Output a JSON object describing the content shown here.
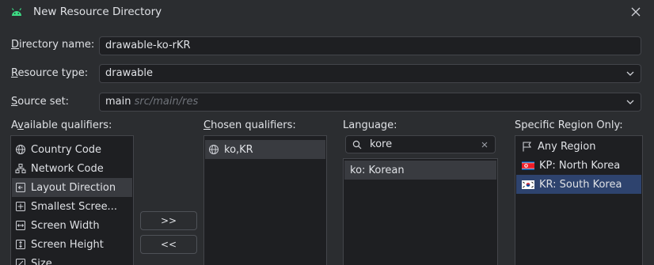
{
  "window": {
    "title": "New Resource Directory"
  },
  "form": {
    "directory_name_label_first": "D",
    "directory_name_label_rest": "irectory name:",
    "directory_name_value": "drawable-ko-rKR",
    "resource_type_label_first": "R",
    "resource_type_label_rest": "esource type:",
    "resource_type_value": "drawable",
    "source_set_label_first": "S",
    "source_set_label_rest": "ource set:",
    "source_set_value": "main",
    "source_set_path": "src/main/res"
  },
  "available": {
    "label_pre": "A",
    "label_u": "v",
    "label_rest": "ailable qualifiers:",
    "items": [
      {
        "label": "Country Code",
        "icon": "globe-icon"
      },
      {
        "label": "Network Code",
        "icon": "network-icon"
      },
      {
        "label": "Layout Direction",
        "icon": "layout-direction-icon"
      },
      {
        "label": "Smallest Scree...",
        "icon": "smallest-screen-icon"
      },
      {
        "label": "Screen Width",
        "icon": "screen-width-icon"
      },
      {
        "label": "Screen Height",
        "icon": "screen-height-icon"
      },
      {
        "label": "Size",
        "icon": "size-icon"
      }
    ]
  },
  "buttons": {
    "add": ">>",
    "remove": "<<"
  },
  "chosen": {
    "label_first": "C",
    "label_rest": "hosen qualifiers:",
    "items": [
      {
        "label": "ko,KR",
        "icon": "globe-icon"
      }
    ]
  },
  "language": {
    "label": "Language:",
    "search_value": "kore",
    "items": [
      {
        "label": "ko: Korean"
      }
    ]
  },
  "region": {
    "label": "Specific Region Only:",
    "items": [
      {
        "label": "Any Region",
        "icon": "flag-outline-icon"
      },
      {
        "label": "KP: North Korea",
        "icon": "north-korea-flag-icon"
      },
      {
        "label": "KR: South Korea",
        "icon": "south-korea-flag-icon"
      }
    ]
  },
  "colors": {
    "selection": "#2e436e",
    "android_green": "#3ddc84"
  }
}
